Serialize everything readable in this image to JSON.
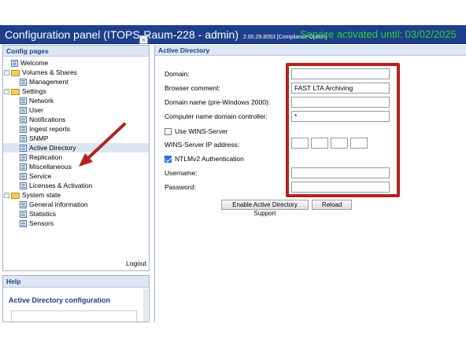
{
  "header": {
    "title": "Configuration panel (ITOPS-Raum-228 - admin)",
    "version": "2.00.29.8053 [Compliance Option]",
    "service_status": "Service activated until: 03/02/2025"
  },
  "sidebar": {
    "heading": "Config pages",
    "collapse_glyph": "«",
    "items": [
      {
        "label": "Welcome",
        "icon": "page-icon"
      },
      {
        "label": "Volumes & Shares",
        "icon": "folder-icon"
      },
      {
        "label": "Management",
        "icon": "page-icon"
      },
      {
        "label": "Settings",
        "icon": "folder-icon"
      },
      {
        "label": "Network",
        "icon": "page-icon"
      },
      {
        "label": "User",
        "icon": "page-icon"
      },
      {
        "label": "Notifications",
        "icon": "page-icon"
      },
      {
        "label": "Ingest reports",
        "icon": "page-icon"
      },
      {
        "label": "SNMP",
        "icon": "page-icon"
      },
      {
        "label": "Active Directory",
        "icon": "page-icon",
        "selected": true
      },
      {
        "label": "Replication",
        "icon": "page-icon"
      },
      {
        "label": "Miscellaneous",
        "icon": "page-icon"
      },
      {
        "label": "Service",
        "icon": "page-icon"
      },
      {
        "label": "Licenses & Activation",
        "icon": "page-icon"
      },
      {
        "label": "System state",
        "icon": "folder-icon"
      },
      {
        "label": "General information",
        "icon": "page-icon"
      },
      {
        "label": "Statistics",
        "icon": "page-icon"
      },
      {
        "label": "Sensors",
        "icon": "page-icon"
      }
    ],
    "logout_label": "Logout"
  },
  "help": {
    "heading": "Help",
    "title": "Active Directory configuration"
  },
  "main": {
    "heading": "Active Directory",
    "form": {
      "domain_label": "Domain:",
      "domain_value": "",
      "browser_comment_label": "Browser comment:",
      "browser_comment_value": "FAST LTA Archiving",
      "domain_name_pre2000_label": "Domain name (pre-Windows 2000):",
      "domain_name_pre2000_value": "",
      "computer_name_dc_label": "Computer name domain controller:",
      "computer_name_dc_value": "*",
      "use_wins_label": "Use WINS-Server",
      "use_wins_checked": false,
      "wins_ip_label": "WINS-Server IP address:",
      "ntlmv2_label": "NTLMv2 Authentication",
      "ntlmv2_checked": true,
      "username_label": "Username:",
      "username_value": "",
      "password_label": "Password:",
      "password_value": ""
    },
    "enable_button": "Enable Active Directory Support",
    "reload_button": "Reload"
  },
  "colors": {
    "header_bg": "#1e3f8a",
    "service_status": "#2fd13a",
    "annotation": "#b3231d"
  }
}
